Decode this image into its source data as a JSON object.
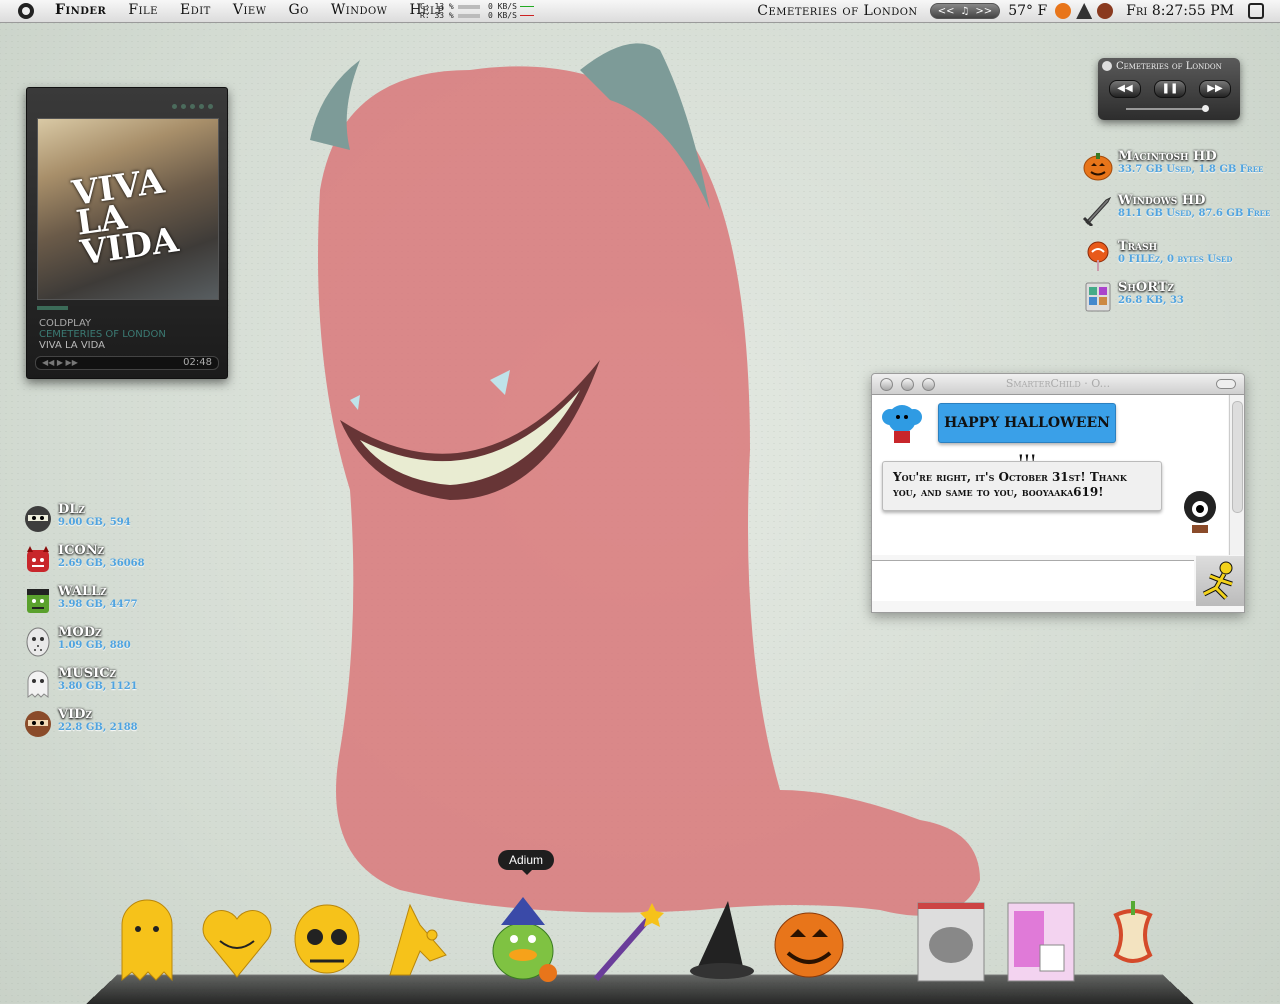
{
  "menubar": {
    "items": [
      {
        "label": "Finder",
        "bold": true
      },
      {
        "label": "File"
      },
      {
        "label": "Edit"
      },
      {
        "label": "View"
      },
      {
        "label": "Go"
      },
      {
        "label": "Window"
      },
      {
        "label": "Help"
      }
    ],
    "cpu_stats": {
      "c": "C: 13 %",
      "r": "R: 33 %"
    },
    "net_stats": {
      "up": "0 KB/S",
      "down": "0 KB/S"
    },
    "now_playing": "Cemeteries of London",
    "player_controls": {
      "prev": "<<",
      "note": "♫",
      "next": ">>"
    },
    "temperature": "57° F",
    "clock": "Fri 8:27:55 PM"
  },
  "itunes_widget": {
    "album_art_text": "VIVA LA VIDA",
    "progress_fraction": 0.17,
    "artist": "COLDPLAY",
    "track": "CEMETERIES OF LONDON",
    "album": "VIVA LA VIDA",
    "controls": "◀◀ ▶ ▶▶",
    "time": "02:48"
  },
  "mini_player": {
    "title": "Cemeteries of London",
    "prev": "◀◀",
    "pause": "❚❚",
    "next": "▶▶"
  },
  "drives_right": [
    {
      "name": "Macintosh HD",
      "detail": "33.7 GB Used, 1.8 GB Free",
      "icon": "pumpkin-icon"
    },
    {
      "name": "Windows HD",
      "detail": "81.1 GB Used, 87.6 GB Free",
      "icon": "dagger-icon"
    },
    {
      "name": "Trash",
      "detail": "0 FILEz, 0 bytes Used",
      "icon": "lollipop-icon"
    },
    {
      "name": "ShORTz",
      "detail": "26.8 KB, 33",
      "icon": "grid-folder-icon"
    }
  ],
  "drives_left": [
    {
      "name": "DLz",
      "detail": "9.00 GB, 594",
      "icon": "ninja-icon",
      "color": "#3d3d3d"
    },
    {
      "name": "ICONz",
      "detail": "2.69 GB, 36068",
      "icon": "red-devil-icon",
      "color": "#c8262b"
    },
    {
      "name": "WALLz",
      "detail": "3.98 GB, 4477",
      "icon": "frankenstein-icon",
      "color": "#5aa12d"
    },
    {
      "name": "MODz",
      "detail": "1.09 GB, 880",
      "icon": "hockey-mask-icon",
      "color": "#e9e9e9"
    },
    {
      "name": "MUSICz",
      "detail": "3.80 GB, 1121",
      "icon": "ghost-icon",
      "color": "#f2f2f2"
    },
    {
      "name": "VIDz",
      "detail": "22.8 GB, 2188",
      "icon": "ninja-brown-icon",
      "color": "#8a4b2a"
    }
  ],
  "chat_window": {
    "title": "SmarterChild · O...",
    "incoming_message": "HAPPY HALLOWEEN !!!",
    "outgoing_message": "You're right, it's October 31st! Thank you, and same to you, booyaaka619!",
    "input_value": ""
  },
  "dock": {
    "tooltip": "Adium",
    "items": [
      {
        "icon": "yellow-ghost-icon",
        "color": "#f6c21a"
      },
      {
        "icon": "heart-icon",
        "color": "#f6c21a"
      },
      {
        "icon": "sugar-skull-icon",
        "color": "#f6c21a"
      },
      {
        "icon": "bat-icon",
        "color": "#f6c21a"
      },
      {
        "icon": "adium-duck-witch-icon",
        "color": "#7fc242"
      },
      {
        "icon": "magic-wand-icon",
        "color": "#6a3d9a"
      },
      {
        "icon": "witch-hat-icon",
        "color": "#222222"
      },
      {
        "icon": "jack-o-lantern-icon",
        "color": "#e8751a"
      },
      {
        "icon": "screenshot-app-icon",
        "color": "#b0b0b0"
      },
      {
        "icon": "pink-cup-icon",
        "color": "#e07ad8"
      },
      {
        "icon": "apple-core-trash-icon",
        "color": "#d44a2a"
      }
    ]
  },
  "colors": {
    "accent_blue": "#3aa0e8",
    "label_blue": "#4fa3e0",
    "monster_pink": "#d9787a"
  }
}
